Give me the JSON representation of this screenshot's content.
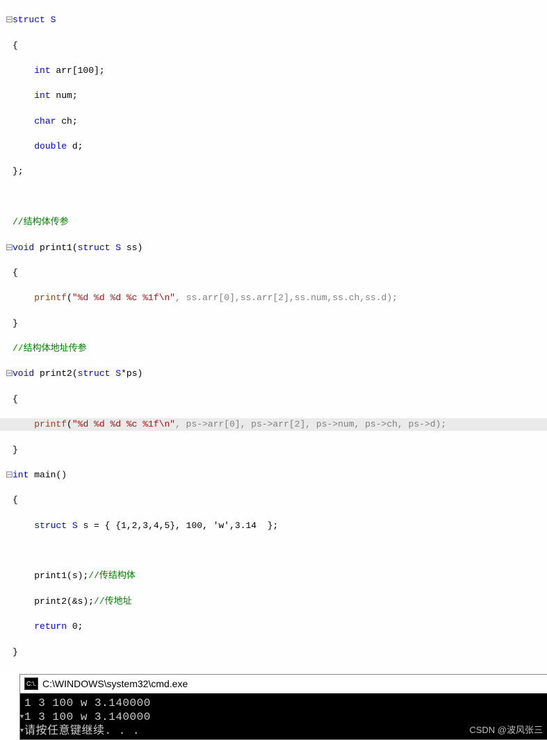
{
  "gutter": {
    "collapse": "⊟"
  },
  "code": {
    "l1": {
      "kw": "struct",
      "name": "S"
    },
    "l2": "{",
    "l3": {
      "indent": "    ",
      "type": "int",
      "rest": " arr[100];"
    },
    "l4": {
      "indent": "    ",
      "type": "int",
      "rest": " num;"
    },
    "l5": {
      "indent": "    ",
      "type": "char",
      "rest": " ch;"
    },
    "l6": {
      "indent": "    ",
      "type": "double",
      "rest": " d;"
    },
    "l7": "};",
    "l8": "",
    "l9": "//结构体传参",
    "l10": {
      "type": "void",
      "name": "print1",
      "args_kw": "struct",
      "args_type": "S",
      "args_rest": " ss)"
    },
    "l11": "{",
    "l12": {
      "indent": "    ",
      "fn": "printf",
      "str": "\"%d %d %d %c %1f\\n\"",
      "rest": ", ss.arr[0],ss.arr[2],ss.num,ss.ch,ss.d);"
    },
    "l13": "}",
    "l14": "//结构体地址传参",
    "l15": {
      "type": "void",
      "name": "print2",
      "args_kw": "struct",
      "args_type": "S",
      "args_rest": "*ps)"
    },
    "l16": "{",
    "l17": {
      "indent": "    ",
      "fn": "printf",
      "str": "\"%d %d %d %c %1f\\n\"",
      "rest": ", ps->arr[0], ps->arr[2], ps->num, ps->ch, ps->d);"
    },
    "l18": "}",
    "l19": {
      "type": "int",
      "name": "main",
      "rest": "()"
    },
    "l20": "{",
    "l21": {
      "indent": "    ",
      "kw": "struct",
      "type": "S",
      "rest": " s = { {1,2,3,4,5}, 100, 'w',3.14  };"
    },
    "l22": "",
    "l23": {
      "indent": "    ",
      "call": "print1(s);",
      "comment": "//传结构体"
    },
    "l24": {
      "indent": "    ",
      "call": "print2(&s);",
      "comment": "//传地址"
    },
    "l25": {
      "indent": "    ",
      "kw": "return",
      "val": " 0;"
    },
    "l26": "}"
  },
  "terminal": {
    "icon": "C:\\.",
    "title": "C:\\WINDOWS\\system32\\cmd.exe",
    "out1": "1 3 100 w 3.140000",
    "out2": "1 3 100 w 3.140000",
    "out3": "请按任意键继续. . ."
  },
  "watermark": "CSDN @波风张三"
}
